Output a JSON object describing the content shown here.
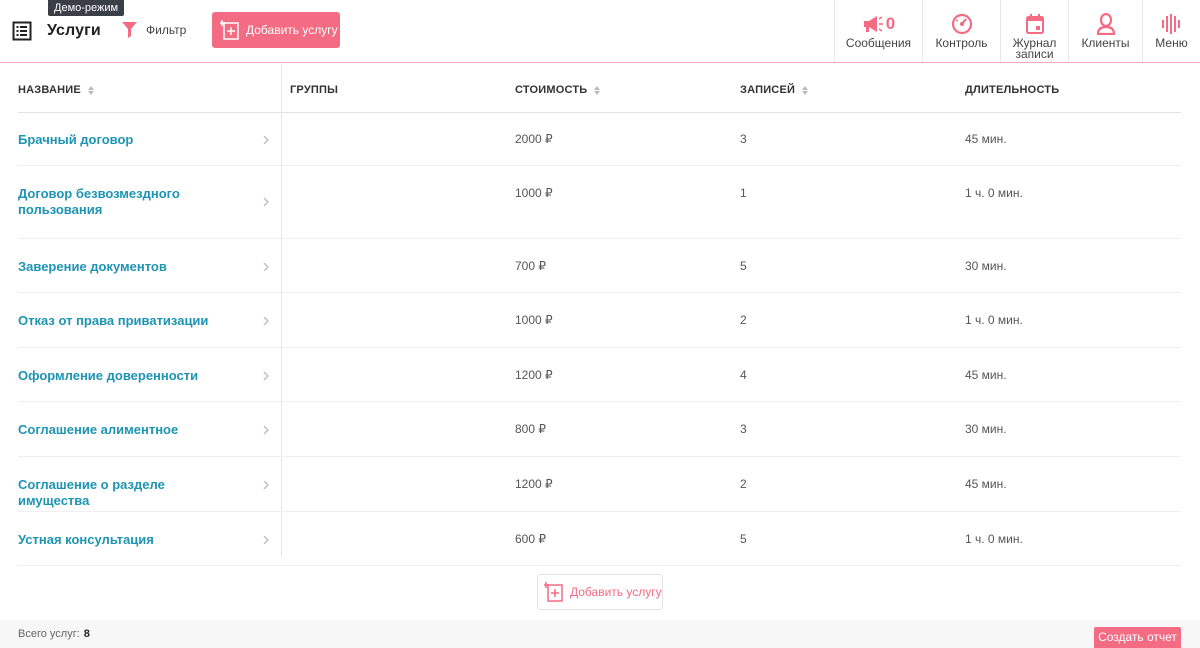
{
  "header": {
    "demo_badge": "Демо-режим",
    "title": "Услуги",
    "filter_label": "Фильтр",
    "add_button_label": "Добавить услугу",
    "nav": [
      {
        "label": "Сообщения",
        "icon": "megaphone-icon",
        "count": "0"
      },
      {
        "label": "Контроль",
        "icon": "speedometer-icon"
      },
      {
        "label": "Журнал записи",
        "icon": "calendar-icon"
      },
      {
        "label": "Клиенты",
        "icon": "user-icon"
      },
      {
        "label": "Меню",
        "icon": "menu-bars-icon"
      }
    ]
  },
  "table": {
    "columns": [
      "НАЗВАНИЕ",
      "ГРУППЫ",
      "СТОИМОСТЬ",
      "ЗАПИСЕЙ",
      "ДЛИТЕЛЬНОСТЬ"
    ],
    "rows": [
      {
        "name": "Брачный договор",
        "group": "",
        "price": "2000 ₽",
        "records": "3",
        "duration": "45 мин."
      },
      {
        "name": "Договор безвозмездного пользования",
        "group": "",
        "price": "1000 ₽",
        "records": "1",
        "duration": "1 ч. 0 мин."
      },
      {
        "name": "Заверение документов",
        "group": "",
        "price": "700 ₽",
        "records": "5",
        "duration": "30 мин."
      },
      {
        "name": "Отказ от права приватизации",
        "group": "",
        "price": "1000 ₽",
        "records": "2",
        "duration": "1 ч. 0 мин."
      },
      {
        "name": "Оформление доверенности",
        "group": "",
        "price": "1200 ₽",
        "records": "4",
        "duration": "45 мин."
      },
      {
        "name": "Соглашение алиментное",
        "group": "",
        "price": "800 ₽",
        "records": "3",
        "duration": "30 мин."
      },
      {
        "name": "Соглашение о разделе имущества",
        "group": "",
        "price": "1200 ₽",
        "records": "2",
        "duration": "45 мин."
      },
      {
        "name": "Устная консультация",
        "group": "",
        "price": "600 ₽",
        "records": "5",
        "duration": "1 ч. 0 мин."
      }
    ]
  },
  "add_button_bottom_label": "Добавить услугу",
  "footer": {
    "total_label": "Всего услуг:",
    "total_value": "8",
    "report_button": "Создать отчет"
  },
  "colors": {
    "accent": "#f46c83",
    "link": "#1e94b3",
    "badge_bg": "#3a3f47"
  }
}
